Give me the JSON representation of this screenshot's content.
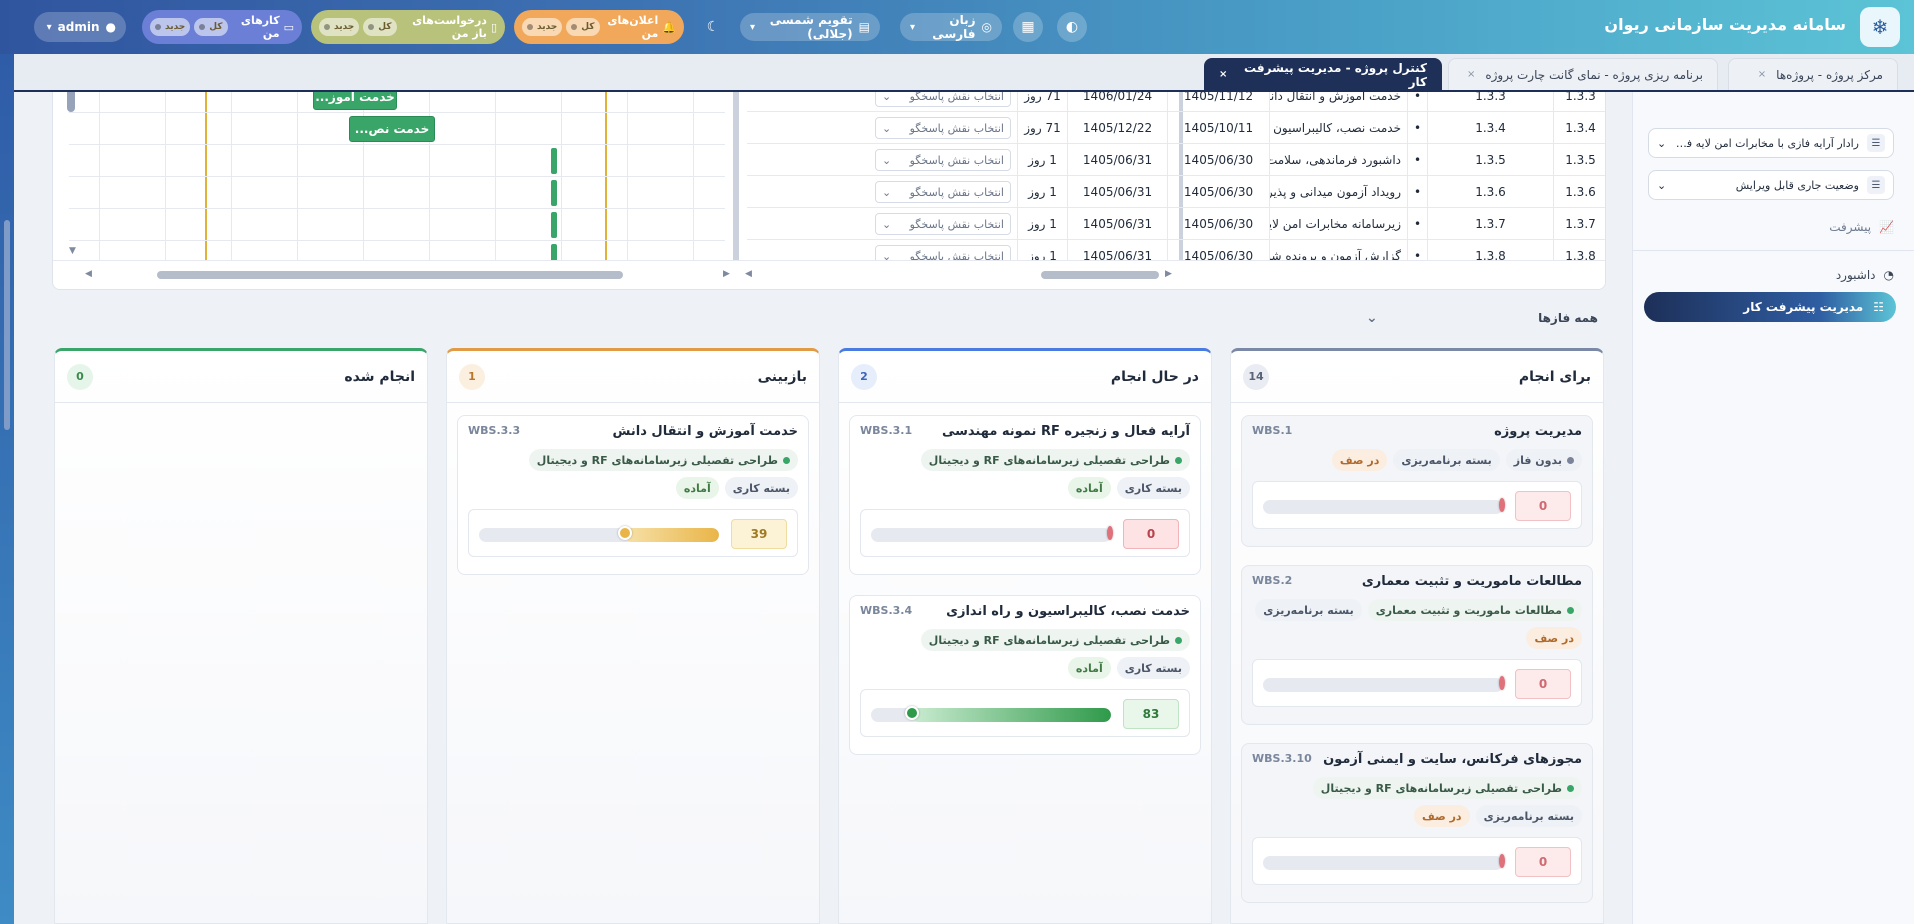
{
  "app": {
    "title": "سامانه مدیریت سازمانی ریوان",
    "logo": "❄"
  },
  "topbar": {
    "admin": "admin",
    "my_tasks": {
      "label": "کارهای من",
      "all": "کل",
      "new": "جدید"
    },
    "open_requests": {
      "label": "درخواست‌های باز من",
      "all": "کل",
      "new": "جدید"
    },
    "my_notifications": {
      "label": "اعلان‌های من",
      "all": "کل",
      "new": "جدید"
    },
    "calendar": "تقویم  شمسی (جلالی)",
    "language": "زبان  فارسی",
    "icons": [
      "theme-toggle-icon",
      "building-icon",
      "palette-icon",
      "globe-icon",
      "calendar-icon"
    ]
  },
  "tabs": [
    {
      "label": "مرکز پروژه  -  پروژه‌ها",
      "close": "×"
    },
    {
      "label": "برنامه ریزی پروژه  -  نمای گانت چارت پروژه",
      "close": "×"
    },
    {
      "label": "کنترل پروژه  -  مدیریت پیشرفت کار",
      "close": "×",
      "active": true
    }
  ],
  "sidebar": {
    "select1": "رادار آرایه فازی با مخابرات امن لایه فیزیکی",
    "select2": "وضعیت جاری قابل ویرایش",
    "progress": "پیشرفت",
    "dashboard": "داشبورد",
    "active_item": "مدیریت پیشرفت کار"
  },
  "gantt": {
    "role_placeholder": "انتخاب نقش پاسخگو",
    "rows": [
      {
        "no": "1.3.3",
        "code": "1.3.3",
        "name": "خدمت آموزش و انتقال دانش",
        "start": "1405/11/12",
        "end": "1406/01/24",
        "dur": "71 روز"
      },
      {
        "no": "1.3.4",
        "code": "1.3.4",
        "name": "خدمت نصب، کالیبراسیون و راه اندازی",
        "start": "1405/10/11",
        "end": "1405/12/22",
        "dur": "71 روز"
      },
      {
        "no": "1.3.5",
        "code": "1.3.5",
        "name": "داشبورد فرماندهی، سلامت",
        "start": "1405/06/30",
        "end": "1405/06/31",
        "dur": "1 روز"
      },
      {
        "no": "1.3.6",
        "code": "1.3.6",
        "name": "رویداد آزمون میدانی و پذیرش",
        "start": "1405/06/30",
        "end": "1405/06/31",
        "dur": "1 روز"
      },
      {
        "no": "1.3.7",
        "code": "1.3.7",
        "name": "زیرسامانه مخابرات امن لایه",
        "start": "1405/06/30",
        "end": "1405/06/31",
        "dur": "1 روز"
      },
      {
        "no": "1.3.8",
        "code": "1.3.8",
        "name": "گزارش آزمون و پرونده شواهد",
        "start": "1405/06/30",
        "end": "1405/06/31",
        "dur": "1 روز"
      }
    ],
    "bars": [
      {
        "label": "خدمت آموز..."
      },
      {
        "label": "خدمت نص..."
      }
    ]
  },
  "phases": {
    "label": "همه فازها"
  },
  "kanban": {
    "todo": {
      "title": "برای انجام",
      "count": "14",
      "cards": [
        {
          "title": "مدیریت پروژه",
          "wbs": "WBS.1",
          "tags": [
            "بدون فاز",
            "بسته برنامه‌ریزی",
            "در صف"
          ],
          "progress": 0
        },
        {
          "title": "مطالعات ماموریت و تثبیت معماری",
          "wbs": "WBS.2",
          "tags": [
            "مطالعات ماموریت و تثبیت معماری",
            "بسته برنامه‌ریزی",
            "در صف"
          ],
          "progress": 0
        },
        {
          "title": "مجوزهای فرکانس، سایت و ایمنی آزمون",
          "wbs": "WBS.3.10",
          "tags": [
            "طراحی تفصیلی زیرسامانه‌های RF و دیجیتال",
            "بسته برنامه‌ریزی",
            "در صف"
          ],
          "progress": 0
        }
      ]
    },
    "doing": {
      "title": "در حال انجام",
      "count": "2",
      "cards": [
        {
          "title": "آرایه فعال و زنجیره RF نمونه مهندسی",
          "wbs": "WBS.3.1",
          "tags": [
            "طراحی تفصیلی زیرسامانه‌های RF و دیجیتال",
            "بسته کاری",
            "آماده"
          ],
          "progress": 0
        },
        {
          "title": "خدمت نصب، کالیبراسیون و راه اندازی",
          "wbs": "WBS.3.4",
          "tags": [
            "طراحی تفصیلی زیرسامانه‌های RF و دیجیتال",
            "بسته کاری",
            "آماده"
          ],
          "progress": 83
        }
      ]
    },
    "review": {
      "title": "بازبینی",
      "count": "1",
      "cards": [
        {
          "title": "خدمت آموزش و انتقال دانش",
          "wbs": "WBS.3.3",
          "tags": [
            "طراحی تفصیلی زیرسامانه‌های RF و دیجیتال",
            "بسته کاری",
            "آماده"
          ],
          "progress": 39
        }
      ]
    },
    "done": {
      "title": "انجام شده",
      "count": "0",
      "cards": []
    }
  },
  "colors": {
    "accent": "#1e2f58",
    "green": "#3aa569",
    "gold": "#e1b23a",
    "red": "#e0707a"
  }
}
